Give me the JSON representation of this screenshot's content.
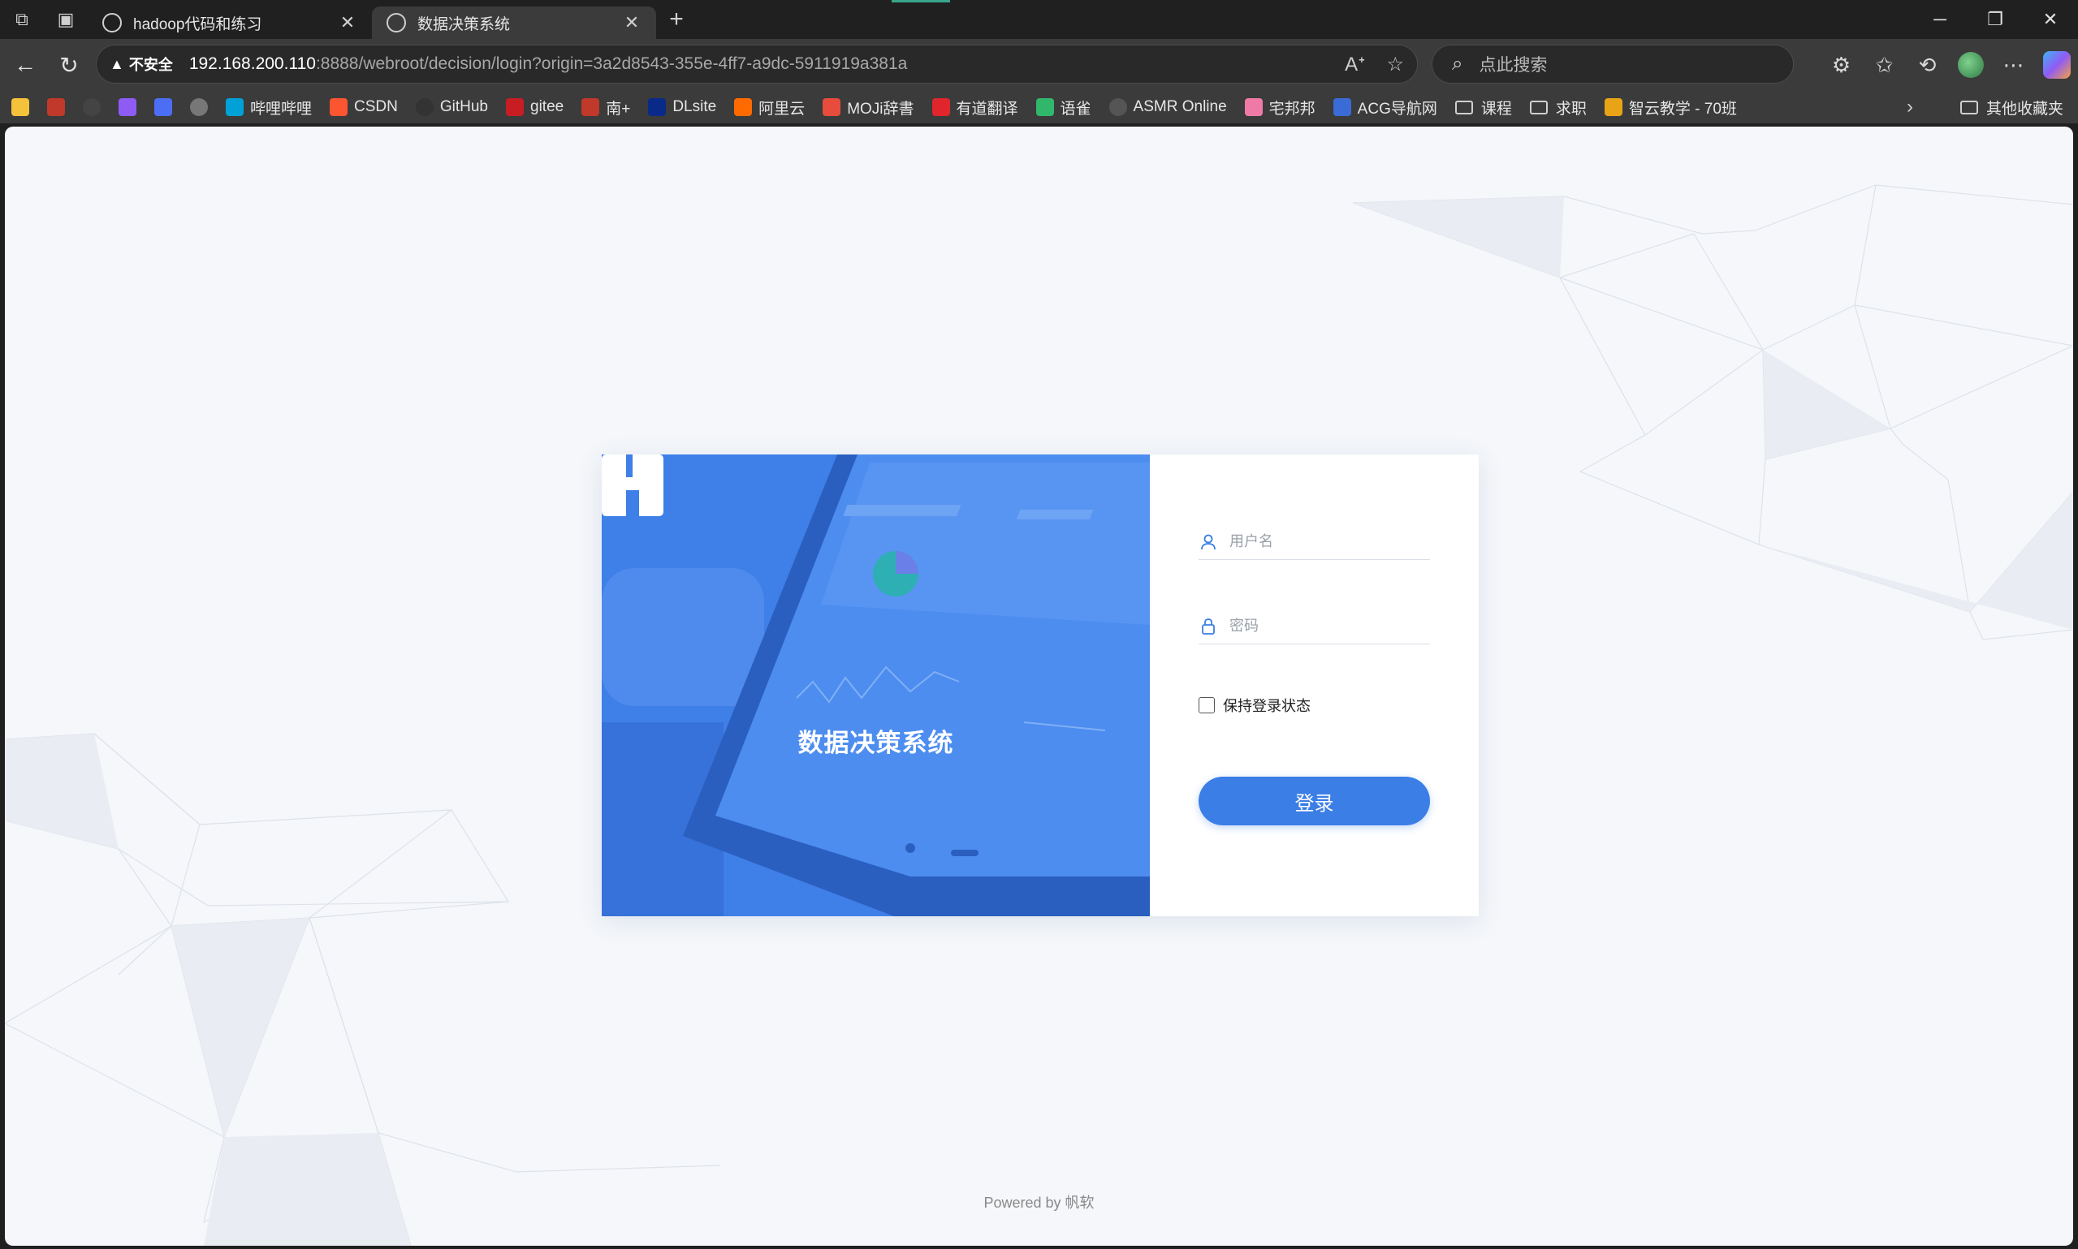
{
  "browser": {
    "tabs": [
      {
        "title": "hadoop代码和练习",
        "active": false
      },
      {
        "title": "数据决策系统",
        "active": true
      }
    ],
    "security_label": "不安全",
    "url_host": "192.168.200.110",
    "url_rest": ":8888/webroot/decision/login?origin=3a2d8543-355e-4ff7-a9dc-5911919a381a",
    "search_placeholder": "点此搜索",
    "bookmarks": [
      {
        "label": "",
        "icon": "smiley-icon",
        "color": "#f5c33b"
      },
      {
        "label": "",
        "icon": "red-glyph-icon",
        "color": "#c0392b"
      },
      {
        "label": "",
        "icon": "openai-icon",
        "color": "#444444"
      },
      {
        "label": "",
        "icon": "copilot-icon",
        "color": "#8f5bf5"
      },
      {
        "label": "",
        "icon": "bird-icon",
        "color": "#4b6ef5"
      },
      {
        "label": "",
        "icon": "avatar-icon",
        "color": "#777777"
      },
      {
        "label": "哔哩哔哩",
        "icon": "bilibili-icon",
        "color": "#00a1d6"
      },
      {
        "label": "CSDN",
        "icon": "csdn-icon",
        "color": "#fc5531"
      },
      {
        "label": "GitHub",
        "icon": "github-icon",
        "color": "#333333"
      },
      {
        "label": "gitee",
        "icon": "gitee-icon",
        "color": "#c71d23"
      },
      {
        "label": "南+",
        "icon": "south-plus-icon",
        "color": "#c0392b"
      },
      {
        "label": "DLsite",
        "icon": "dlsite-icon",
        "color": "#0a2a8a"
      },
      {
        "label": "阿里云",
        "icon": "aliyun-icon",
        "color": "#ff6a00"
      },
      {
        "label": "MOJi辞書",
        "icon": "moji-icon",
        "color": "#e74c3c"
      },
      {
        "label": "有道翻译",
        "icon": "youdao-icon",
        "color": "#e0262c"
      },
      {
        "label": "语雀",
        "icon": "yuque-icon",
        "color": "#31b76b"
      },
      {
        "label": "ASMR Online",
        "icon": "globe-icon",
        "color": "#555555"
      },
      {
        "label": "宅邦邦",
        "icon": "zhaibangbang-icon",
        "color": "#f07aa7"
      },
      {
        "label": "ACG导航网",
        "icon": "acg-icon",
        "color": "#3b6bd6"
      },
      {
        "label": "课程",
        "icon": "folder-icon",
        "color": ""
      },
      {
        "label": "求职",
        "icon": "folder-icon",
        "color": ""
      },
      {
        "label": "智云教学 - 70班",
        "icon": "zhiyun-icon",
        "color": "#e8a317"
      }
    ],
    "other_bookmarks": "其他收藏夹"
  },
  "login": {
    "brand_title": "数据决策系统",
    "username_placeholder": "用户名",
    "password_placeholder": "密码",
    "remember_label": "保持登录状态",
    "login_button": "登录",
    "footer": "Powered by 帆软"
  },
  "colors": {
    "accent": "#3a7ee6",
    "panel_blue": "#3a78e0",
    "page_bg": "#f5f7fa",
    "chrome_dark": "#202020",
    "chrome_toolbar": "#3b3b3b"
  }
}
